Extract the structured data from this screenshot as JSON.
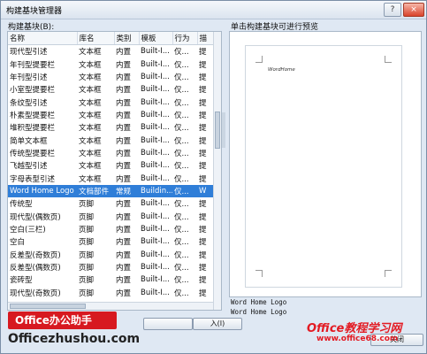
{
  "window": {
    "title": "构建基块管理器",
    "help": "?",
    "close": "×"
  },
  "labels": {
    "blocks": "构建基块(B):",
    "preview": "单击构建基块可进行预览"
  },
  "table": {
    "headers": [
      "名称",
      "库名",
      "类别",
      "模板",
      "行为",
      "描"
    ],
    "rows": [
      [
        "现代型引述",
        "文本框",
        "内置",
        "Built-I...",
        "仅...",
        "提"
      ],
      [
        "年刊型提要栏",
        "文本框",
        "内置",
        "Built-I...",
        "仅...",
        "提"
      ],
      [
        "年刊型引述",
        "文本框",
        "内置",
        "Built-I...",
        "仅...",
        "提"
      ],
      [
        "小室型提要栏",
        "文本框",
        "内置",
        "Built-I...",
        "仅...",
        "提"
      ],
      [
        "条纹型引述",
        "文本框",
        "内置",
        "Built-I...",
        "仅...",
        "提"
      ],
      [
        "朴素型提要栏",
        "文本框",
        "内置",
        "Built-I...",
        "仅...",
        "提"
      ],
      [
        "堆积型提要栏",
        "文本框",
        "内置",
        "Built-I...",
        "仅...",
        "提"
      ],
      [
        "简单文本框",
        "文本框",
        "内置",
        "Built-I...",
        "仅...",
        "提"
      ],
      [
        "传统型提要栏",
        "文本框",
        "内置",
        "Built-I...",
        "仅...",
        "提"
      ],
      [
        "飞越型引述",
        "文本框",
        "内置",
        "Built-I...",
        "仅...",
        "提"
      ],
      [
        "字母表型引述",
        "文本框",
        "内置",
        "Built-I...",
        "仅...",
        "提"
      ],
      [
        "Word Home Logo",
        "文档部件",
        "常规",
        "Buildin...",
        "仅...",
        "W"
      ],
      [
        "传统型",
        "页脚",
        "内置",
        "Built-I...",
        "仅...",
        "提"
      ],
      [
        "现代型(偶数页)",
        "页脚",
        "内置",
        "Built-I...",
        "仅...",
        "提"
      ],
      [
        "空白(三栏)",
        "页脚",
        "内置",
        "Built-I...",
        "仅...",
        "提"
      ],
      [
        "空白",
        "页脚",
        "内置",
        "Built-I...",
        "仅...",
        "提"
      ],
      [
        "反差型(奇数页)",
        "页脚",
        "内置",
        "Built-I...",
        "仅...",
        "提"
      ],
      [
        "反差型(偶数页)",
        "页脚",
        "内置",
        "Built-I...",
        "仅...",
        "提"
      ],
      [
        "瓷砖型",
        "页脚",
        "内置",
        "Built-I...",
        "仅...",
        "提"
      ],
      [
        "现代型(奇数页)",
        "页脚",
        "内置",
        "Built-I...",
        "仅...",
        "提"
      ]
    ]
  },
  "preview": {
    "doc_text": "WordHome",
    "name": "Word Home Logo",
    "description": "Word Home Logo"
  },
  "buttons": {
    "left": "",
    "insert": "入(I)",
    "close": "关闭"
  },
  "watermark": {
    "badge": "Office办公助手",
    "site": "Officezhushou.com",
    "right": "Office教程学习网",
    "url": "www.office68.com"
  }
}
